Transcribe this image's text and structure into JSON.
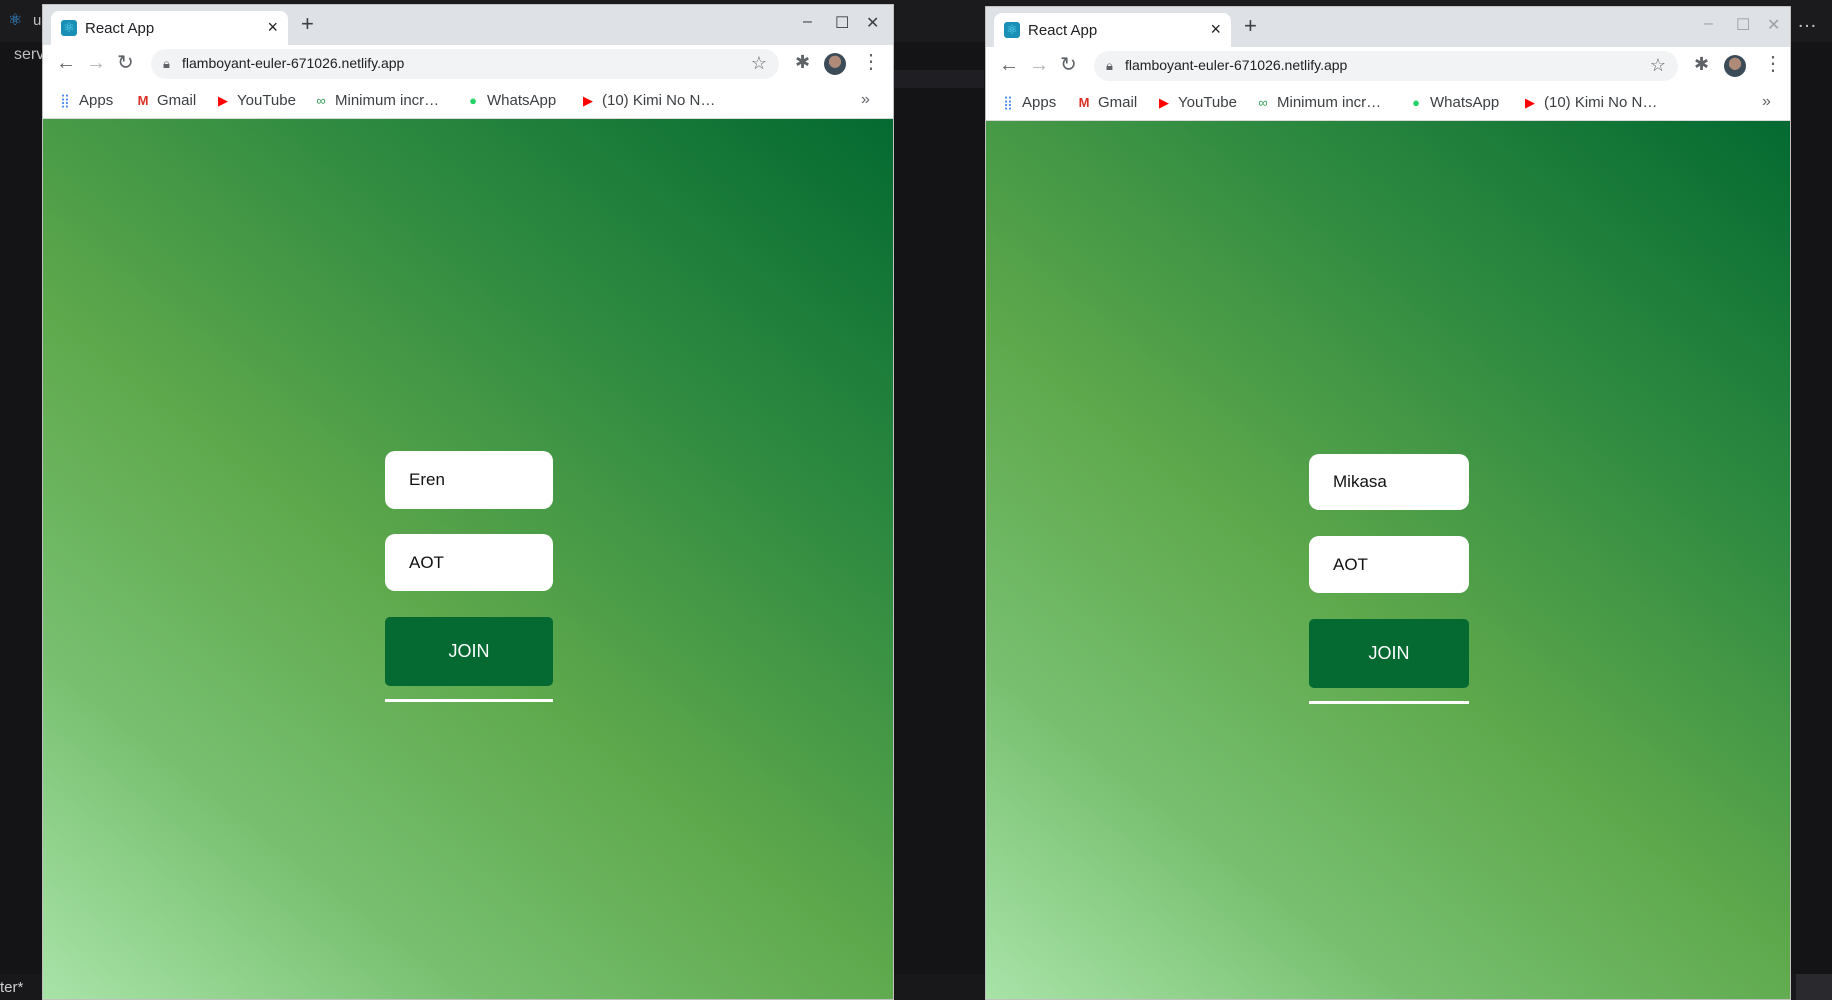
{
  "background": {
    "app_text": "u",
    "left_text": "serv",
    "status_text": "ter*"
  },
  "windows": [
    {
      "tab_title": "React App",
      "url": "flamboyant-euler-671026.netlify.app",
      "bookmarks": [
        {
          "label": "Apps",
          "icon": "apps-grid-icon"
        },
        {
          "label": "Gmail",
          "icon": "gmail-icon"
        },
        {
          "label": "YouTube",
          "icon": "youtube-icon"
        },
        {
          "label": "Minimum incr…",
          "icon": "link-icon"
        },
        {
          "label": "WhatsApp",
          "icon": "whatsapp-icon"
        },
        {
          "label": "(10) Kimi No N…",
          "icon": "youtube-icon"
        }
      ],
      "form": {
        "name": "Eren",
        "room": "AOT",
        "join_label": "JOIN"
      }
    },
    {
      "tab_title": "React App",
      "url": "flamboyant-euler-671026.netlify.app",
      "bookmarks": [
        {
          "label": "Apps",
          "icon": "apps-grid-icon"
        },
        {
          "label": "Gmail",
          "icon": "gmail-icon"
        },
        {
          "label": "YouTube",
          "icon": "youtube-icon"
        },
        {
          "label": "Minimum incr…",
          "icon": "link-icon"
        },
        {
          "label": "WhatsApp",
          "icon": "whatsapp-icon"
        },
        {
          "label": "(10) Kimi No N…",
          "icon": "youtube-icon"
        }
      ],
      "form": {
        "name": "Mikasa",
        "room": "AOT",
        "join_label": "JOIN"
      }
    }
  ],
  "colors": {
    "join_button": "#046a31",
    "gradient_light": "#a8e3a8",
    "gradient_dark": "#046a31",
    "youtube": "#ff0000",
    "whatsapp": "#25d366"
  }
}
